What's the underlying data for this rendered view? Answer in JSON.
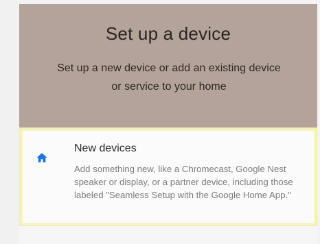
{
  "header": {
    "title": "Set up a device",
    "subtitle": "Set up a new device or add an existing device or service to your home"
  },
  "new_devices": {
    "icon": "home-icon",
    "title": "New devices",
    "description": "Add something new, like a Chromecast, Google Nest speaker or display, or a partner device, including those labeled \"Seamless Setup with the Google Home App.\""
  },
  "colors": {
    "header_bg": "#b3a39a",
    "icon_blue": "#1a73e8",
    "highlight_border": "#f3eeb3"
  }
}
